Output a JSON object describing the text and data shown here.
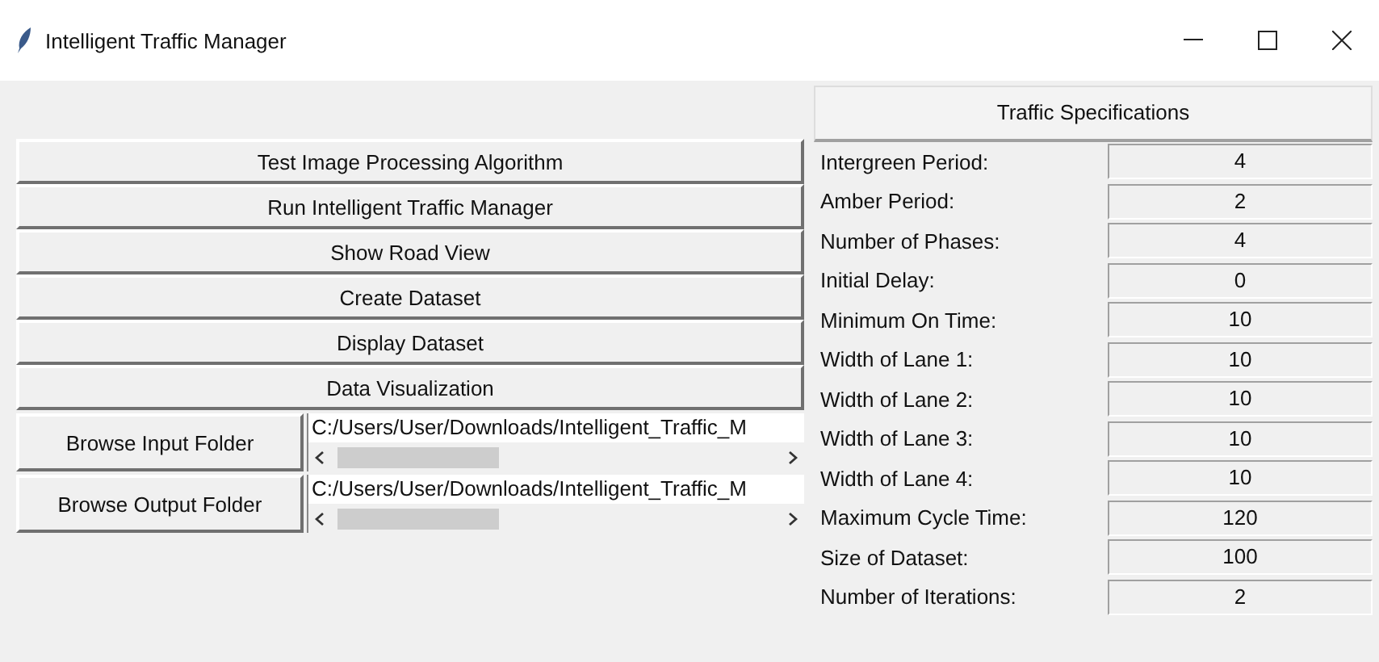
{
  "window": {
    "title": "Intelligent Traffic Manager"
  },
  "actions": [
    {
      "label": "Test Image Processing Algorithm"
    },
    {
      "label": "Run Intelligent Traffic Manager"
    },
    {
      "label": "Show Road View"
    },
    {
      "label": "Create Dataset"
    },
    {
      "label": "Display Dataset"
    },
    {
      "label": "Data Visualization"
    }
  ],
  "folders": [
    {
      "button": "Browse Input Folder",
      "path": "C:/Users/User/Downloads/Intelligent_Traffic_M"
    },
    {
      "button": "Browse Output Folder",
      "path": "C:/Users/User/Downloads/Intelligent_Traffic_M"
    }
  ],
  "specifications": {
    "title": "Traffic Specifications",
    "rows": [
      {
        "label": "Intergreen Period:",
        "value": "4"
      },
      {
        "label": "Amber Period:",
        "value": "2"
      },
      {
        "label": "Number of Phases:",
        "value": "4"
      },
      {
        "label": "Initial Delay:",
        "value": "0"
      },
      {
        "label": "Minimum On Time:",
        "value": "10"
      },
      {
        "label": "Width of Lane 1:",
        "value": "10"
      },
      {
        "label": "Width of Lane 2:",
        "value": "10"
      },
      {
        "label": "Width of Lane 3:",
        "value": "10"
      },
      {
        "label": "Width of Lane 4:",
        "value": "10"
      },
      {
        "label": "Maximum Cycle Time:",
        "value": "120"
      },
      {
        "label": "Size of Dataset:",
        "value": "100"
      },
      {
        "label": "Number of Iterations:",
        "value": "2"
      }
    ]
  }
}
